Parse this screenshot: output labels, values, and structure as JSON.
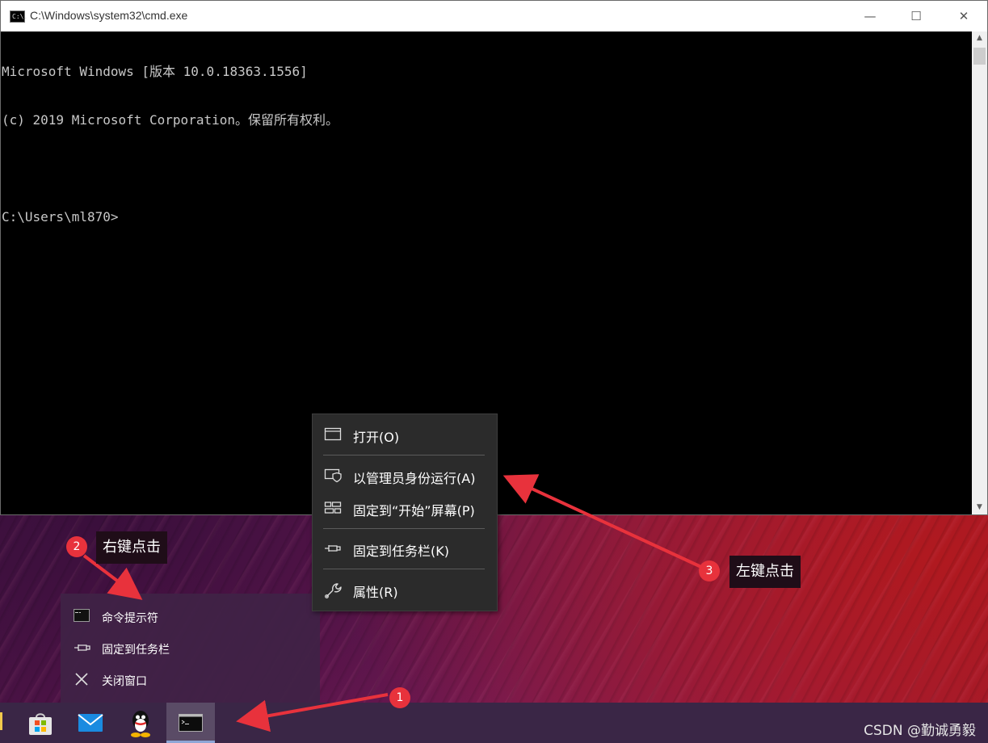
{
  "window": {
    "title": "C:\\Windows\\system32\\cmd.exe",
    "icon": "cmd-icon",
    "icon_text": "C:\\.",
    "minimize": "—",
    "maximize": "☐",
    "close": "✕"
  },
  "console": {
    "lines": [
      "Microsoft Windows [版本 10.0.18363.1556]",
      "(c) 2019 Microsoft Corporation。保留所有权利。",
      "",
      "C:\\Users\\ml870>"
    ]
  },
  "scrollbar": {
    "up": "▲",
    "down": "▼"
  },
  "context_menu": {
    "items": [
      {
        "label": "打开(O)",
        "icon": "window-icon"
      },
      {
        "label": "以管理员身份运行(A)",
        "icon": "admin-shield-icon"
      },
      {
        "label": "固定到“开始”屏幕(P)",
        "icon": "start-tiles-icon"
      },
      {
        "label": "固定到任务栏(K)",
        "icon": "pin-icon"
      },
      {
        "label": "属性(R)",
        "icon": "wrench-icon"
      }
    ]
  },
  "jump_list": {
    "items": [
      {
        "label": "命令提示符",
        "icon": "cmd-icon"
      },
      {
        "label": "固定到任务栏",
        "icon": "pin-icon"
      },
      {
        "label": "关闭窗口",
        "icon": "close-icon"
      }
    ]
  },
  "taskbar": {
    "apps": [
      {
        "name": "Microsoft Store",
        "icon": "store-icon"
      },
      {
        "name": "Mail",
        "icon": "mail-icon"
      },
      {
        "name": "QQ",
        "icon": "qq-icon"
      },
      {
        "name": "Command Prompt",
        "icon": "cmd-icon",
        "active": true
      }
    ]
  },
  "annotations": {
    "badge1": "1",
    "badge2": "2",
    "badge3": "3",
    "label2": "右键点击",
    "label3": "左键点击",
    "arrow_color": "#e8323c"
  },
  "watermark": "CSDN @勤诚勇毅"
}
